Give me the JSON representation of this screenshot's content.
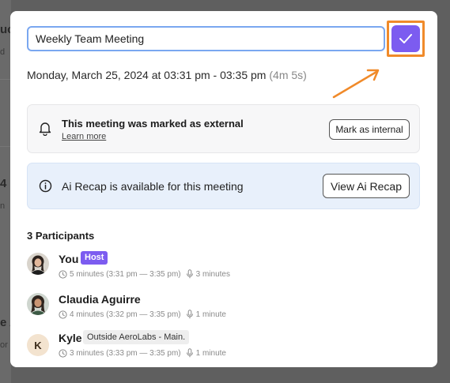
{
  "background": {
    "fragments": [
      "uc",
      "d",
      "4",
      "n",
      "e A",
      "or"
    ]
  },
  "modal": {
    "title_value": "Weekly Team Meeting",
    "datetime": "Monday, March 25, 2024 at 03:31 pm - 03:35 pm",
    "duration": "(4m 5s)",
    "external_notice": {
      "title": "This meeting was marked as external",
      "link": "Learn more",
      "button": "Mark as internal"
    },
    "recap_notice": {
      "text": "Ai Recap is available for this meeting",
      "button": "View Ai Recap"
    },
    "participants_header": "3 Participants",
    "participants": [
      {
        "name": "You",
        "badge": "Host",
        "time": "5 minutes (3:31 pm — 3:35 pm)",
        "talk": "3 minutes"
      },
      {
        "name": "Claudia Aguirre",
        "badge": "",
        "time": "4 minutes (3:32 pm — 3:35 pm)",
        "talk": "1 minute"
      },
      {
        "name": "Kyle",
        "badge": "Outside AeroLabs - Main.",
        "initial": "K",
        "time": "3 minutes (3:33 pm — 3:35 pm)",
        "talk": "1 minute"
      }
    ]
  },
  "colors": {
    "accent": "#7c5cf0",
    "highlight": "#f08a2a",
    "input_border": "#7aa7f0",
    "recap_bg": "#e8f0fb"
  },
  "icons": [
    "check-icon",
    "bell-icon",
    "info-icon",
    "clock-icon",
    "microphone-icon",
    "annotation-arrow"
  ]
}
